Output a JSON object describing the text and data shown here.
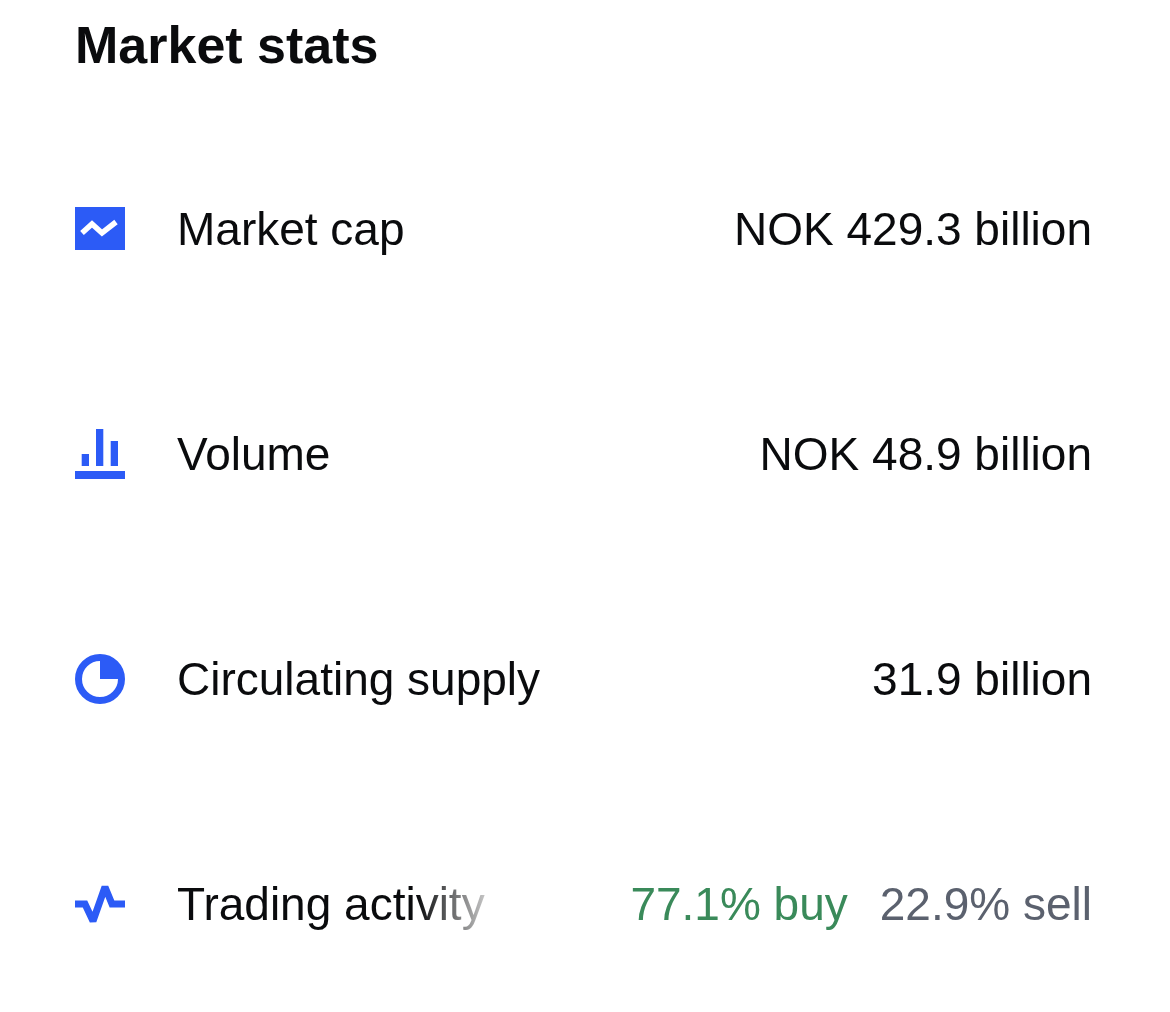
{
  "title": "Market stats",
  "stats": [
    {
      "kind": "market-cap",
      "label": "Market cap",
      "value": "NOK 429.3 billion"
    },
    {
      "kind": "volume",
      "label": "Volume",
      "value": "NOK 48.9 billion"
    },
    {
      "kind": "supply",
      "label": "Circulating supply",
      "value": "31.9 billion"
    },
    {
      "kind": "activity",
      "label": "Trading activity",
      "buy": "77.1% buy",
      "sell": "22.9% sell"
    }
  ]
}
